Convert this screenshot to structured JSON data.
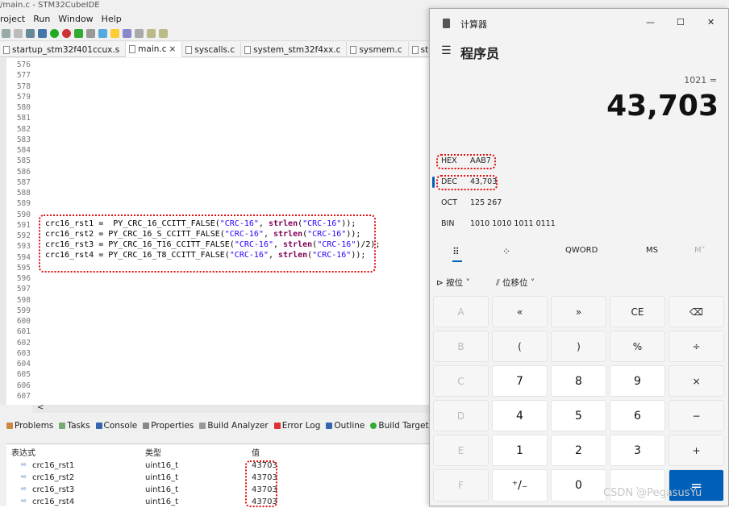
{
  "ide": {
    "title": "/main.c - STM32CubeIDE",
    "menu": [
      "roject",
      "Run",
      "Window",
      "Help"
    ],
    "tabs": [
      {
        "label": "startup_stm32f401ccux.s",
        "close": ""
      },
      {
        "label": "main.c",
        "close": "×"
      },
      {
        "label": "syscalls.c",
        "close": ""
      },
      {
        "label": "system_stm32f4xx.c",
        "close": ""
      },
      {
        "label": "sysmem.c",
        "close": ""
      },
      {
        "label": "st",
        "close": ""
      }
    ],
    "line_numbers": [
      "576",
      "577",
      "578",
      "579",
      "580",
      "581",
      "582",
      "583",
      "584",
      "585",
      "586",
      "587",
      "588",
      "589",
      "590",
      "591",
      "592",
      "593",
      "594",
      "595",
      "596",
      "597",
      "598",
      "599",
      "600",
      "601",
      "602",
      "603",
      "604",
      "605",
      "606",
      "607"
    ],
    "code": [
      {
        "lhs": "crc16_rst1 =  PY_CRC_16_CCITT_FALSE(",
        "s1": "\"CRC-16\"",
        "mid": ", ",
        "k": "strlen",
        "p": "(",
        "s2": "\"CRC-16\"",
        "tail": "));"
      },
      {
        "lhs": "crc16_rst2 = PY_CRC_16_S_CCITT_FALSE(",
        "s1": "\"CRC-16\"",
        "mid": ", ",
        "k": "strlen",
        "p": "(",
        "s2": "\"CRC-16\"",
        "tail": "));"
      },
      {
        "lhs": "crc16_rst3 = PY_CRC_16_T16_CCITT_FALSE(",
        "s1": "\"CRC-16\"",
        "mid": ", ",
        "k": "strlen",
        "p": "(",
        "s2": "\"CRC-16\"",
        "tail": ")/2);"
      },
      {
        "lhs": "crc16_rst4 = PY_CRC_16_T8_CCITT_FALSE(",
        "s1": "\"CRC-16\"",
        "mid": ", ",
        "k": "strlen",
        "p": "(",
        "s2": "\"CRC-16\"",
        "tail": "));"
      }
    ],
    "hscroll_arrow": "<",
    "bottom_tabs": [
      "Problems",
      "Tasks",
      "Console",
      "Properties",
      "Build Analyzer",
      "Error Log",
      "Outline",
      "Build Targets"
    ],
    "expressions": {
      "headers": [
        "表达式",
        "类型",
        "值"
      ],
      "rows": [
        {
          "name": "crc16_rst1",
          "type": "uint16_t",
          "value": "43703"
        },
        {
          "name": "crc16_rst2",
          "type": "uint16_t",
          "value": "43703"
        },
        {
          "name": "crc16_rst3",
          "type": "uint16_t",
          "value": "43703"
        },
        {
          "name": "crc16_rst4",
          "type": "uint16_t",
          "value": "43703"
        }
      ],
      "row_prefix": "⁰⁰"
    }
  },
  "calculator": {
    "title": "计算器",
    "mode": "程序员",
    "expression": "1021 =",
    "display": "43,703",
    "radix": [
      {
        "label": "HEX",
        "value": "AAB7"
      },
      {
        "label": "DEC",
        "value": "43,703"
      },
      {
        "label": "OCT",
        "value": "125 267"
      },
      {
        "label": "BIN",
        "value": "1010 1010 1011 0111"
      }
    ],
    "word_size": "QWORD",
    "memory": [
      "MS",
      "M˅"
    ],
    "bitwise": "按位",
    "bitshift": "位移位",
    "window_controls": [
      "—",
      "☐",
      "✕"
    ],
    "keys": [
      [
        "A",
        "«",
        "»",
        "CE",
        "⌫"
      ],
      [
        "B",
        "(",
        ")",
        "%",
        "÷"
      ],
      [
        "C",
        "7",
        "8",
        "9",
        "×"
      ],
      [
        "D",
        "4",
        "5",
        "6",
        "−"
      ],
      [
        "E",
        "1",
        "2",
        "3",
        "+"
      ],
      [
        "F",
        "⁺∕₋",
        "0",
        ".",
        "="
      ]
    ],
    "accent": "#005fb8"
  },
  "watermark": "CSDN @PegasusYu"
}
